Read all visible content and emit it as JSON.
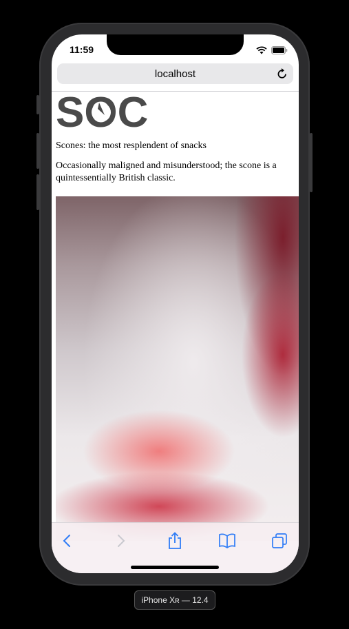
{
  "status_bar": {
    "time": "11:59"
  },
  "browser": {
    "url": "localhost"
  },
  "page": {
    "logo_text": "SOC",
    "headline": "Scones: the most resplendent of snacks",
    "intro": "Occasionally maligned and misunderstood; the scone is a quintessentially British classic."
  },
  "device_label": "iPhone Xʀ — 12.4",
  "colors": {
    "accent": "#007aff",
    "logo": "#4a4a4a"
  }
}
